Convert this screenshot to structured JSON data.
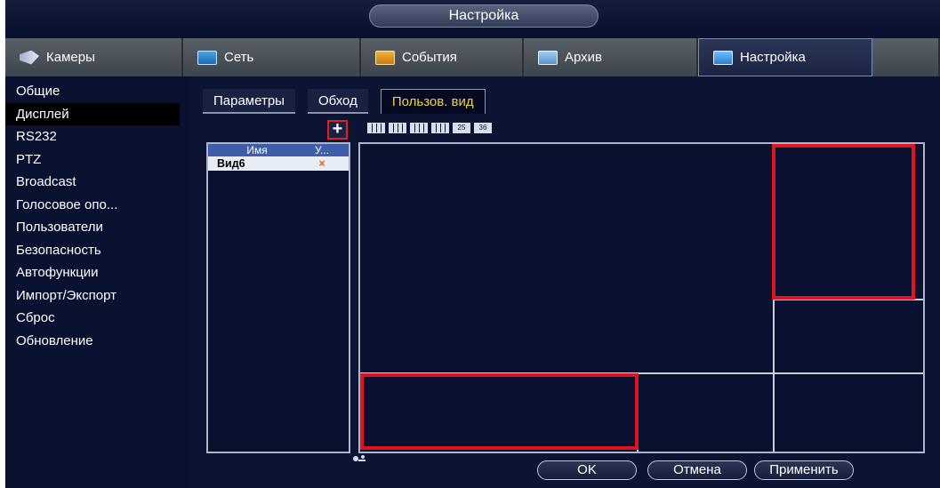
{
  "window": {
    "title": "Настройка"
  },
  "nav": {
    "tabs": [
      {
        "label": "Камеры",
        "icon": "camera-icon"
      },
      {
        "label": "Сеть",
        "icon": "network-icon"
      },
      {
        "label": "События",
        "icon": "events-icon"
      },
      {
        "label": "Архив",
        "icon": "archive-icon"
      },
      {
        "label": "Настройка",
        "icon": "settings-icon",
        "active": true
      }
    ]
  },
  "sidebar": {
    "items": [
      {
        "label": "Общие"
      },
      {
        "label": "Дисплей",
        "active": true
      },
      {
        "label": "RS232"
      },
      {
        "label": "PTZ"
      },
      {
        "label": "Broadcast"
      },
      {
        "label": "Голосовое опо..."
      },
      {
        "label": "Пользователи"
      },
      {
        "label": "Безопасность"
      },
      {
        "label": "Автофункции"
      },
      {
        "label": "Импорт/Экспорт"
      },
      {
        "label": "Сброс"
      },
      {
        "label": "Обновление"
      }
    ]
  },
  "main": {
    "tabs": [
      {
        "label": "Параметры"
      },
      {
        "label": "Обход"
      },
      {
        "label": "Пользов. вид",
        "active": true
      }
    ],
    "add_button": "+",
    "layout_icons": [
      "split-4-icon",
      "split-8-icon",
      "split-9-icon",
      "split-16-icon",
      "split-25-icon",
      "split-36-icon"
    ],
    "layout_labels": [
      "",
      "",
      "",
      "",
      "25",
      "36"
    ],
    "views_table": {
      "headers": [
        "Имя",
        "У..."
      ],
      "rows": [
        {
          "name": "Вид6",
          "delete": "×"
        }
      ]
    }
  },
  "footer": {
    "ok": "OK",
    "cancel": "Отмена",
    "apply": "Применить"
  },
  "colors": {
    "background": "#0b1231",
    "highlight": "#e0141c",
    "active_tab_text": "#f0d24a",
    "delete_icon": "#f05a1e"
  }
}
